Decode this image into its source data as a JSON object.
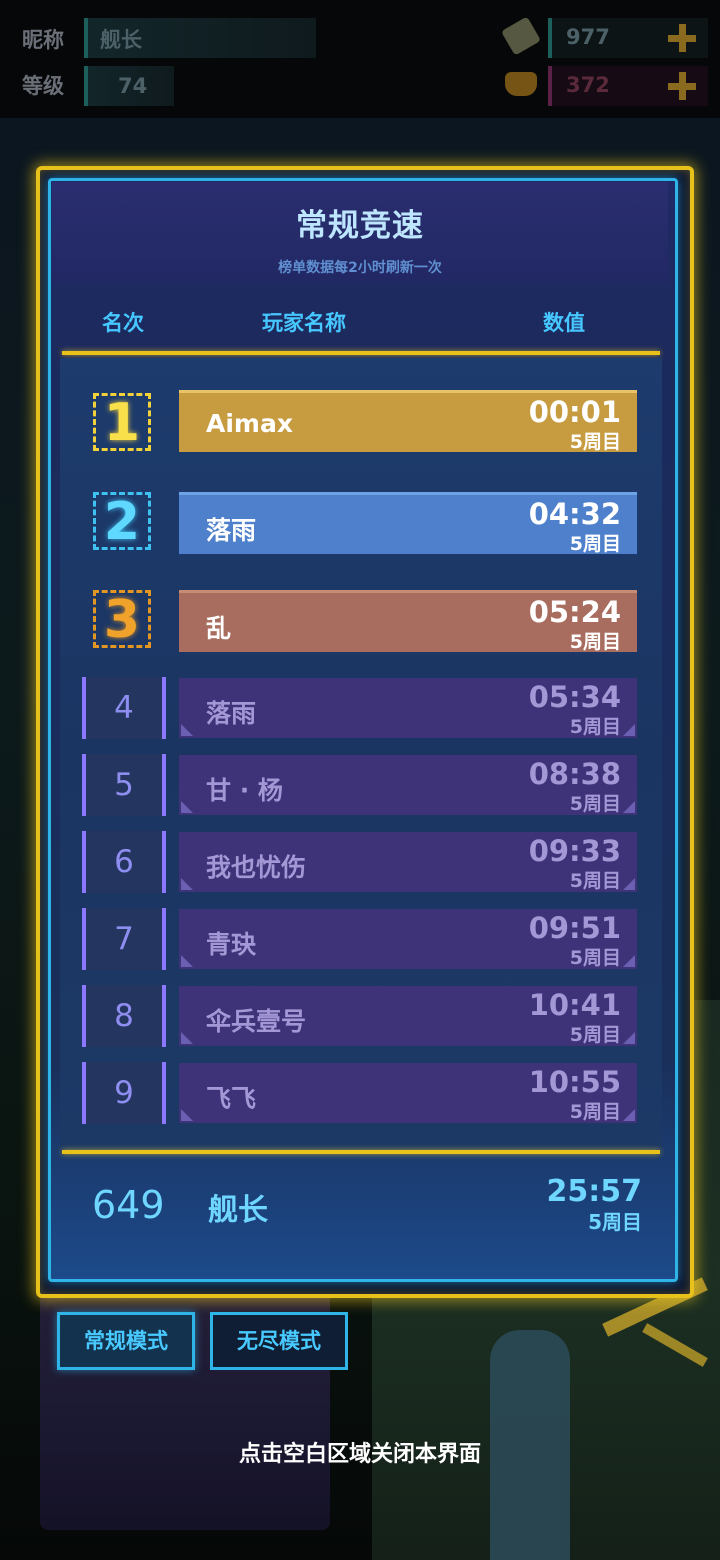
{
  "topbar": {
    "nickname_label": "昵称",
    "nickname_value": "舰长",
    "level_label": "等级",
    "level_value": "74",
    "currency1_icon": "ticket-icon",
    "currency1_value": "977",
    "currency2_icon": "cat-face-icon",
    "currency2_value": "372"
  },
  "panel": {
    "title": "常规竞速",
    "subtitle": "榜单数据每2小时刷新一次",
    "col_rank": "名次",
    "col_player": "玩家名称",
    "col_value": "数值"
  },
  "leaderboard": [
    {
      "rank": "1",
      "name": "Aimax",
      "time": "00:01",
      "lap": "5周目"
    },
    {
      "rank": "2",
      "name": "落雨",
      "time": "04:32",
      "lap": "5周目"
    },
    {
      "rank": "3",
      "name": "乱",
      "time": "05:24",
      "lap": "5周目"
    },
    {
      "rank": "4",
      "name": "落雨",
      "time": "05:34",
      "lap": "5周目"
    },
    {
      "rank": "5",
      "name": "甘 · 杨",
      "time": "08:38",
      "lap": "5周目"
    },
    {
      "rank": "6",
      "name": "我也忧伤",
      "time": "09:33",
      "lap": "5周目"
    },
    {
      "rank": "7",
      "name": "青玦",
      "time": "09:51",
      "lap": "5周目"
    },
    {
      "rank": "8",
      "name": "伞兵壹号",
      "time": "10:41",
      "lap": "5周目"
    },
    {
      "rank": "9",
      "name": "飞飞",
      "time": "10:55",
      "lap": "5周目"
    }
  ],
  "self_row": {
    "rank": "649",
    "name": "舰长",
    "time": "25:57",
    "lap": "5周目"
  },
  "modes": {
    "normal": "常规模式",
    "endless": "无尽模式"
  },
  "close_hint": "点击空白区域关闭本界面",
  "colors": {
    "gold": "#c79c41",
    "blue": "#4f80cc",
    "bronze": "#a86d5e",
    "purple": "#3e3378",
    "frame_yellow": "#e8c21a",
    "frame_cyan": "#2fb4e8"
  }
}
